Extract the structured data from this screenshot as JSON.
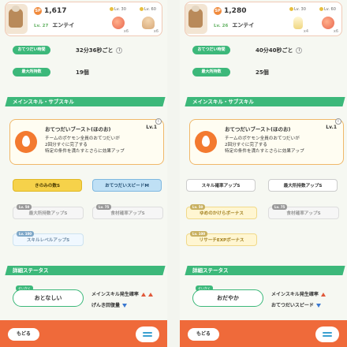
{
  "left": {
    "sp": "1,617",
    "sp_badge": "SP",
    "lv": "Lv. 27",
    "name": "エンテイ",
    "ingredients": [
      {
        "lv": "Lv. 30",
        "icon": "tomato",
        "count": "x6"
      },
      {
        "lv": "Lv. 60",
        "icon": "mushroom",
        "count": "x6"
      }
    ],
    "stats": [
      {
        "label": "おてつだい時間",
        "value": "32分36秒ごと"
      },
      {
        "label": "最大所持数",
        "value": "19個"
      }
    ],
    "section_skills": "メインスキル・サブスキル",
    "skill": {
      "name": "おてつだいブースト(ほのお)",
      "lv": "Lv.1",
      "desc": "チームのポケモン全員のおてつだいが\n2回分すぐに完了する\n特定の条件を満たすとさらに効果アップ"
    },
    "subskills": [
      {
        "label": "きのみの数S",
        "tag": ""
      },
      {
        "label": "おてつだいスピードM",
        "tag": ""
      },
      {
        "label": "最大所持数アップS",
        "tag": "Lv. 50"
      },
      {
        "label": "食材確率アップS",
        "tag": "Lv. 75"
      },
      {
        "label": "スキルレベルアップS",
        "tag": "Lv. 100"
      }
    ],
    "section_detail": "詳細ステータス",
    "nature_tag": "せいかく",
    "nature": "おとなしい",
    "effects": [
      "メインスキル発生確率",
      "げんき回復量"
    ],
    "back": "もどる"
  },
  "right": {
    "sp": "1,280",
    "sp_badge": "SP",
    "lv": "Lv. 26",
    "name": "エンテイ",
    "ingredients": [
      {
        "lv": "Lv. 30",
        "icon": "bottle",
        "count": "x4"
      },
      {
        "lv": "Lv. 60",
        "icon": "tomato",
        "count": "x6"
      }
    ],
    "stats": [
      {
        "label": "おてつだい時間",
        "value": "40分40秒ごと"
      },
      {
        "label": "最大所持数",
        "value": "25個"
      }
    ],
    "section_skills": "メインスキル・サブスキル",
    "skill": {
      "name": "おてつだいブースト(ほのお)",
      "lv": "Lv.1",
      "desc": "チームのポケモン全員のおてつだいが\n2回分すぐに完了する\n特定の条件を満たすとさらに効果アップ"
    },
    "subskills": [
      {
        "label": "スキル確率アップS",
        "tag": ""
      },
      {
        "label": "最大所持数アップS",
        "tag": ""
      },
      {
        "label": "ゆめのかけらボーナス",
        "tag": "Lv. 50"
      },
      {
        "label": "食材確率アップS",
        "tag": "Lv. 75"
      },
      {
        "label": "リサーチEXPボーナス",
        "tag": "Lv. 100"
      }
    ],
    "section_detail": "詳細ステータス",
    "nature_tag": "せいかく",
    "nature": "おだやか",
    "effects": [
      "メインスキル発生確率",
      "おてつだいスピード"
    ],
    "back": "もどる"
  },
  "colors": {
    "accent": "#3cb87a",
    "footer": "#ef6a3a",
    "skill_border": "#f0b86a"
  }
}
